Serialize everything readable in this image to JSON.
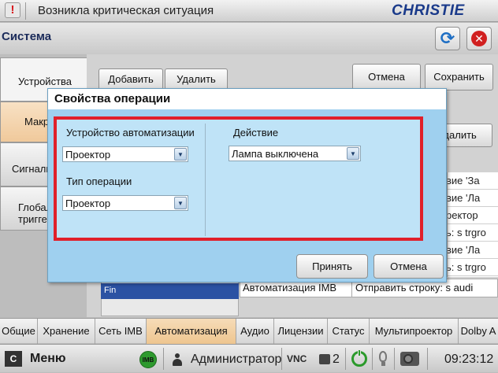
{
  "top_bar": {
    "alert_text": "Возникла критическая ситуация",
    "brand": "CHRISTIE"
  },
  "title_bar": {
    "title": "Система"
  },
  "side_nav": {
    "items": [
      {
        "label": "Устройства"
      },
      {
        "label": "Макр"
      },
      {
        "label": "Сигналь"
      },
      {
        "label": "Глобал\nтригге"
      }
    ]
  },
  "toolbar": {
    "add_label": "Добавить",
    "delete_label": "Удалить",
    "cancel_label": "Отмена",
    "save_label": "Сохранить",
    "delete_right_label": "Удалить"
  },
  "right_table": {
    "rows": [
      {
        "text": "вие 'За"
      },
      {
        "text": "вие 'Ла"
      },
      {
        "text": "ректор"
      },
      {
        "text": "ь: s trgro"
      },
      {
        "text": "вие 'Ла"
      },
      {
        "text": "ь: s trgro"
      }
    ]
  },
  "left_list": {
    "selected_text": "Fin"
  },
  "bottom_row": {
    "col1": "Автоматизация IMB",
    "col2": "Отправить строку: s audi"
  },
  "bottom_tabs": [
    {
      "label": "Общие"
    },
    {
      "label": "Хранение"
    },
    {
      "label": "Сеть IMB"
    },
    {
      "label": "Автоматизация"
    },
    {
      "label": "Аудио"
    },
    {
      "label": "Лицензии"
    },
    {
      "label": "Статус"
    },
    {
      "label": "Мультипроектор"
    },
    {
      "label": "Dolby A"
    }
  ],
  "status_bar": {
    "menu_label": "Меню",
    "imb_badge": "IMB",
    "user": "Администратор",
    "vnc": "VNC",
    "sessions": "2",
    "time": "09:23:12"
  },
  "dialog": {
    "title": "Свойства операции",
    "device_label": "Устройство автоматизации",
    "device_value": "Проектор",
    "op_type_label": "Тип операции",
    "op_type_value": "Проектор",
    "action_label": "Действие",
    "action_value": "Лампа выключена",
    "accept_label": "Принять",
    "cancel_label": "Отмена"
  },
  "colors": {
    "dialog_bg": "#9fd0ef",
    "highlight_border": "#e0202a",
    "active_tab": "#eec58f",
    "brand": "#1a3a8a"
  }
}
